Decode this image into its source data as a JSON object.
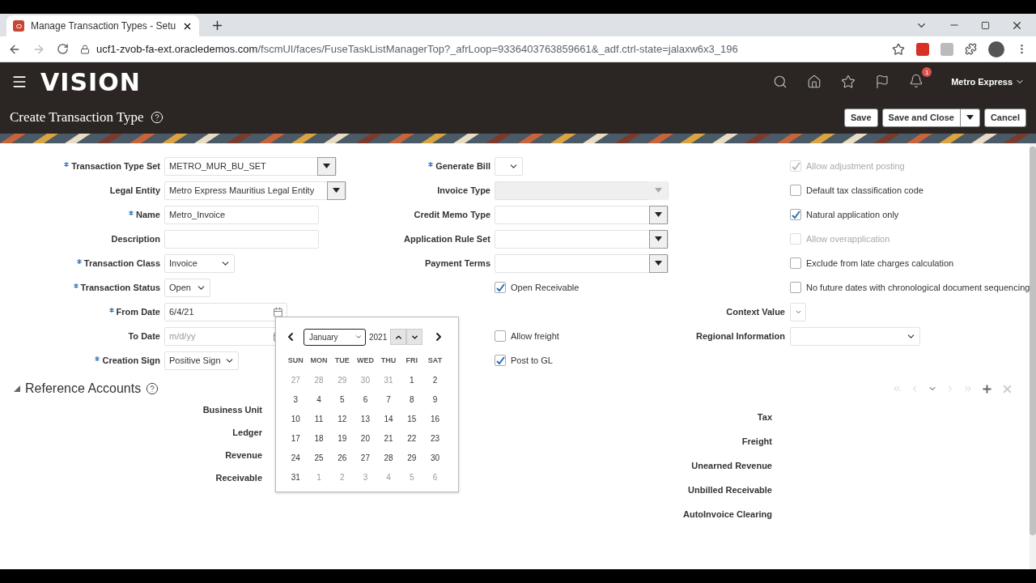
{
  "browser": {
    "tab_title": "Manage Transaction Types - Setu",
    "url_host": "ucf1-zvob-fa-ext.oracledemos.com",
    "url_path": "/fscmUI/faces/FuseTaskListManagerTop?_afrLoop=9336403763859661&_adf.ctrl-state=jalaxw6x3_196"
  },
  "header": {
    "logo": "VISION",
    "notification_count": "1",
    "user": "Metro Express"
  },
  "page": {
    "title": "Create Transaction Type",
    "buttons": [
      {
        "label": "Save",
        "kind": "button"
      },
      {
        "label": "Save and Close",
        "kind": "split"
      },
      {
        "label": "Cancel",
        "kind": "button"
      }
    ]
  },
  "left_fields": [
    {
      "label": "Transaction Type Set",
      "required": true,
      "kind": "lov",
      "value": "METRO_MUR_BU_SET"
    },
    {
      "label": "Legal Entity",
      "required": false,
      "kind": "lov",
      "value": "Metro Express Mauritius Legal Entity"
    },
    {
      "label": "Name",
      "required": true,
      "kind": "text",
      "value": "Metro_Invoice"
    },
    {
      "label": "Description",
      "required": false,
      "kind": "text"
    },
    {
      "label": "Transaction Class",
      "required": true,
      "kind": "select",
      "value": "Invoice"
    },
    {
      "label": "Transaction Status",
      "required": true,
      "kind": "select",
      "value": "Open"
    },
    {
      "label": "From Date",
      "required": true,
      "kind": "date",
      "value": "6/4/21"
    },
    {
      "label": "To Date",
      "required": false,
      "kind": "date",
      "placeholder": "m/d/yy"
    },
    {
      "label": "Creation Sign",
      "required": true,
      "kind": "select",
      "value": "Positive Sign"
    }
  ],
  "middle_fields": [
    {
      "label": "Generate Bill",
      "required": true,
      "kind": "select",
      "disabled": false
    },
    {
      "label": "Invoice Type",
      "required": false,
      "kind": "lov",
      "disabled": true
    },
    {
      "label": "Credit Memo Type",
      "required": false,
      "kind": "lov",
      "disabled": false
    },
    {
      "label": "Application Rule Set",
      "required": false,
      "kind": "lov",
      "disabled": false
    },
    {
      "label": "Payment Terms",
      "required": false,
      "kind": "lov",
      "disabled": false
    },
    {
      "label": "Open Receivable",
      "kind": "checkbox",
      "checked": true,
      "disabled": false
    },
    {
      "label": "Allow freight",
      "kind": "checkbox",
      "checked": false,
      "disabled": false
    },
    {
      "label": "Post to GL",
      "kind": "checkbox",
      "checked": true,
      "disabled": false
    }
  ],
  "right_fields": [
    {
      "label": "Allow adjustment posting",
      "kind": "checkbox",
      "checked": true,
      "disabled": true
    },
    {
      "label": "Default tax classification code",
      "kind": "checkbox",
      "checked": false,
      "disabled": false
    },
    {
      "label": "Natural application only",
      "kind": "checkbox",
      "checked": true,
      "disabled": false
    },
    {
      "label": "Allow overapplication",
      "kind": "checkbox",
      "checked": false,
      "disabled": true
    },
    {
      "label": "Exclude from late charges calculation",
      "kind": "checkbox",
      "checked": false,
      "disabled": false
    },
    {
      "label": "No future dates with chronological document sequencing",
      "kind": "checkbox",
      "checked": false,
      "disabled": false
    },
    {
      "label": "Context Value",
      "kind": "select",
      "disabled": false
    },
    {
      "label": "Regional Information",
      "kind": "select",
      "disabled": false
    }
  ],
  "calendar": {
    "month": "January",
    "year": "2021",
    "weekdays": [
      "SUN",
      "MON",
      "TUE",
      "WED",
      "THU",
      "FRI",
      "SAT"
    ],
    "weeks": [
      [
        {
          "day": "27",
          "outside": true
        },
        {
          "day": "28",
          "outside": true
        },
        {
          "day": "29",
          "outside": true
        },
        {
          "day": "30",
          "outside": true
        },
        {
          "day": "31",
          "outside": true
        },
        {
          "day": "1",
          "outside": false
        },
        {
          "day": "2",
          "outside": false
        }
      ],
      [
        {
          "day": "3",
          "outside": false
        },
        {
          "day": "4",
          "outside": false
        },
        {
          "day": "5",
          "outside": false
        },
        {
          "day": "6",
          "outside": false
        },
        {
          "day": "7",
          "outside": false
        },
        {
          "day": "8",
          "outside": false
        },
        {
          "day": "9",
          "outside": false
        }
      ],
      [
        {
          "day": "10",
          "outside": false
        },
        {
          "day": "11",
          "outside": false
        },
        {
          "day": "12",
          "outside": false
        },
        {
          "day": "13",
          "outside": false
        },
        {
          "day": "14",
          "outside": false
        },
        {
          "day": "15",
          "outside": false
        },
        {
          "day": "16",
          "outside": false
        }
      ],
      [
        {
          "day": "17",
          "outside": false
        },
        {
          "day": "18",
          "outside": false
        },
        {
          "day": "19",
          "outside": false
        },
        {
          "day": "20",
          "outside": false
        },
        {
          "day": "21",
          "outside": false
        },
        {
          "day": "22",
          "outside": false
        },
        {
          "day": "23",
          "outside": false
        }
      ],
      [
        {
          "day": "24",
          "outside": false
        },
        {
          "day": "25",
          "outside": false
        },
        {
          "day": "26",
          "outside": false
        },
        {
          "day": "27",
          "outside": false
        },
        {
          "day": "28",
          "outside": false
        },
        {
          "day": "29",
          "outside": false
        },
        {
          "day": "30",
          "outside": false
        }
      ],
      [
        {
          "day": "31",
          "outside": false
        },
        {
          "day": "1",
          "outside": true
        },
        {
          "day": "2",
          "outside": true
        },
        {
          "day": "3",
          "outside": true
        },
        {
          "day": "4",
          "outside": true
        },
        {
          "day": "5",
          "outside": true
        },
        {
          "day": "6",
          "outside": true
        }
      ]
    ]
  },
  "reference_accounts": {
    "title": "Reference Accounts",
    "left_labels": [
      "Business Unit",
      "Ledger",
      "Revenue",
      "Receivable"
    ],
    "right_labels": [
      "Tax",
      "Freight",
      "Unearned Revenue",
      "Unbilled Receivable",
      "AutoInvoice Clearing"
    ]
  }
}
